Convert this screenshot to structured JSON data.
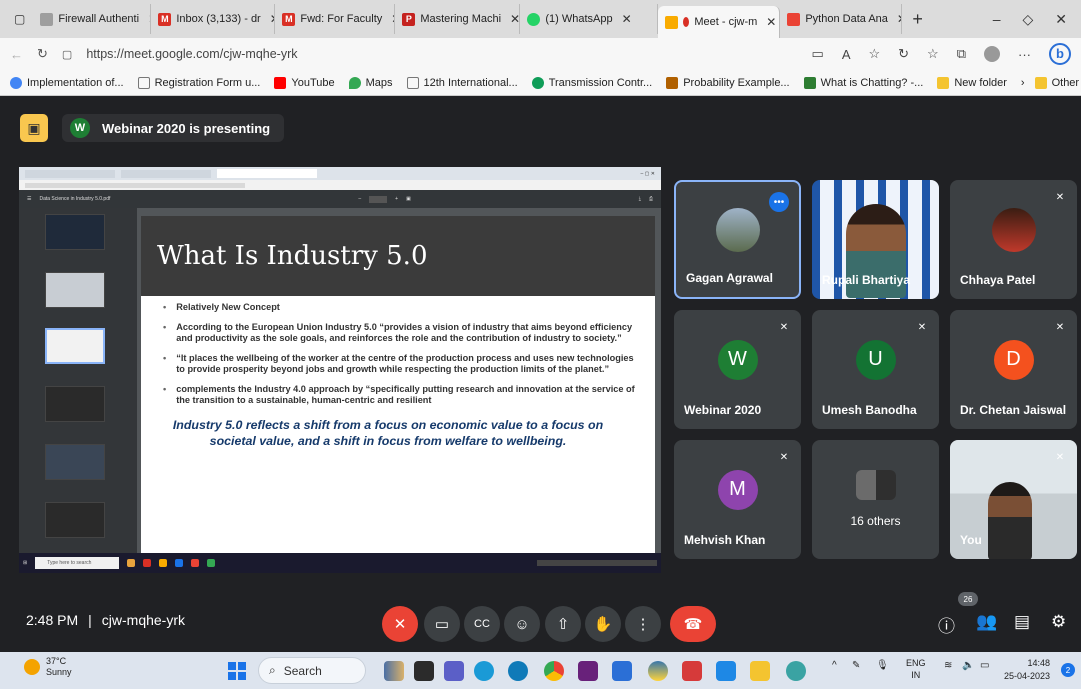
{
  "browser": {
    "tabs": [
      {
        "label": "Firewall Authenti",
        "color": "#9e9e9e"
      },
      {
        "label": "Inbox (3,133) - dr",
        "color": "#d93025"
      },
      {
        "label": "Fwd: For Faculty",
        "color": "#d93025"
      },
      {
        "label": "Mastering Machi",
        "color": "#c5221f"
      },
      {
        "label": "(1) WhatsApp",
        "color": "#25d366"
      },
      {
        "label": "Meet - cjw-m",
        "color": "#f9ab00",
        "active": true
      },
      {
        "label": "Python Data Ana",
        "color": "#ea4335"
      }
    ],
    "url": "https://meet.google.com/cjw-mqhe-yrk",
    "bookmarks": [
      {
        "label": "Implementation of...",
        "color": "#4285f4"
      },
      {
        "label": "Registration Form u...",
        "color": "#777777"
      },
      {
        "label": "YouTube",
        "color": "#ff0000"
      },
      {
        "label": "Maps",
        "color": "#34a853"
      },
      {
        "label": "12th International...",
        "color": "#777777"
      },
      {
        "label": "Transmission Contr...",
        "color": "#0f9d58"
      },
      {
        "label": "Probability Example...",
        "color": "#b06000"
      },
      {
        "label": "What is Chatting? -...",
        "color": "#2e7d32"
      },
      {
        "label": "New folder",
        "color": "#f4c430"
      }
    ],
    "other_favorites": "Other favorites"
  },
  "banner": {
    "avatar_letter": "W",
    "text": "Webinar 2020 is presenting"
  },
  "slide": {
    "title": "What Is Industry 5.0",
    "bullets": [
      "Relatively New Concept",
      "According to the European Union Industry 5.0 “provides a vision of industry that aims beyond efficiency and productivity as the sole goals, and reinforces the role and the contribution of industry to society.”",
      "“It places the wellbeing of the worker at the centre of the production process and uses new technologies to provide prosperity beyond jobs and growth while respecting the production limits of the planet.”",
      "complements the Industry 4.0 approach by “specifically putting research and innovation at the service of the transition to a sustainable, human-centric and resilient"
    ],
    "quote": "Industry 5.0 reflects a shift from a focus on economic value to a focus on societal value, and a shift in focus from welfare to wellbeing.",
    "pdf_name": "Data Science in Industry 5.0.pdf",
    "search_placeholder": "Type here to search"
  },
  "participants": [
    {
      "name": "Gagan Agrawal",
      "type": "photo"
    },
    {
      "name": "Rupali Bhartiya",
      "type": "video"
    },
    {
      "name": "Chhaya Patel",
      "type": "photo"
    },
    {
      "name": "Webinar 2020",
      "letter": "W",
      "color": "#1e7e34"
    },
    {
      "name": "Umesh Banodha",
      "letter": "U",
      "color": "#137333"
    },
    {
      "name": "Dr. Chetan Jaiswal",
      "letter": "D",
      "color": "#f4511e"
    },
    {
      "name": "Mehvish Khan",
      "letter": "M",
      "color": "#8e44ad"
    },
    {
      "name": "16 others",
      "type": "others"
    },
    {
      "name": "You",
      "type": "video"
    }
  ],
  "controls": {
    "time": "2:48 PM",
    "separator": "|",
    "meeting_code": "cjw-mqhe-yrk",
    "participant_count": "26"
  },
  "taskbar": {
    "temp": "37°C",
    "weather": "Sunny",
    "search": "Search",
    "lang": "ENG",
    "region": "IN",
    "time": "14:48",
    "date": "25-04-2023",
    "notifications": "2"
  }
}
